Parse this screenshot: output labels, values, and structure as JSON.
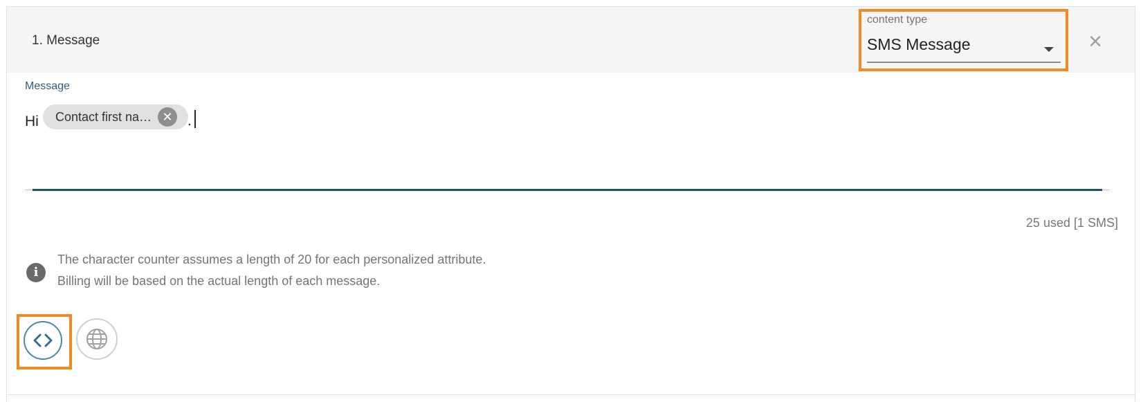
{
  "header": {
    "step_title": "1. Message",
    "content_type": {
      "label": "content type",
      "value": "SMS Message"
    },
    "close_glyph": "×"
  },
  "message": {
    "label": "Message",
    "text_before": "Hi",
    "token": {
      "label": "Contact first na…",
      "remove_glyph": "✕"
    },
    "text_after": ".",
    "counter": "25 used [1 SMS]"
  },
  "info": {
    "icon_glyph": "i",
    "line1": "The character counter assumes a length of 20 for each personalized attribute.",
    "line2": "Billing will be based on the actual length of each message."
  },
  "icons": {
    "code_icon": "code-icon",
    "globe_icon": "globe-icon",
    "info_icon": "info-icon"
  },
  "colors": {
    "highlight": "#f08a24",
    "accent": "#1c4e6e",
    "header_bg": "#f5f5f5"
  }
}
